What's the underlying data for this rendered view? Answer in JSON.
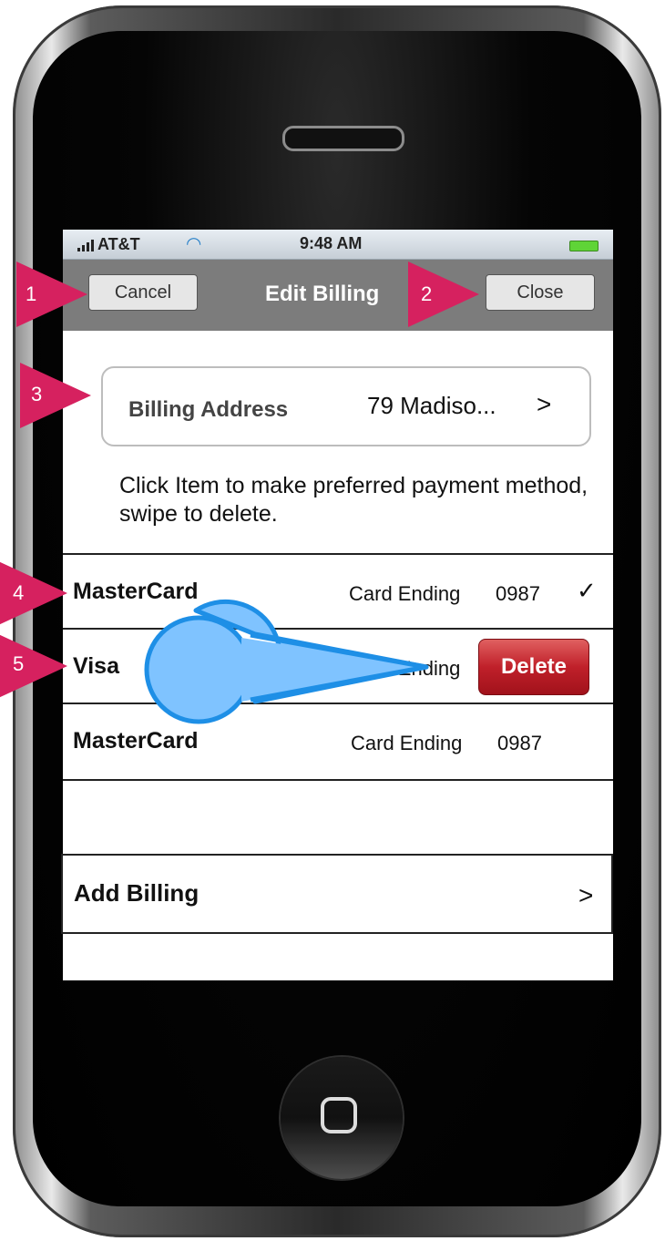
{
  "status_bar": {
    "carrier": "AT&T",
    "time": "9:48 AM"
  },
  "nav": {
    "title": "Edit Billing",
    "cancel_label": "Cancel",
    "close_label": "Close"
  },
  "billing_address": {
    "label": "Billing Address",
    "value": "79 Madiso...",
    "chevron": ">"
  },
  "hint": "Click Item to make preferred payment method, swipe to delete.",
  "cards": [
    {
      "name": "MasterCard",
      "ending_label": "Card Ending",
      "ending_number": "0987",
      "check": "✓"
    },
    {
      "name": "Visa",
      "ending_label": "Card Ending",
      "delete_label": "Delete"
    },
    {
      "name": "MasterCard",
      "ending_label": "Card Ending",
      "ending_number": "0987"
    }
  ],
  "add_billing": {
    "label": "Add Billing",
    "chevron": ">"
  },
  "annotations": [
    "1",
    "2",
    "3",
    "4",
    "5"
  ],
  "colors": {
    "marker": "#d6215f",
    "nav_bar": "#7c7c7c",
    "delete": "#c0202a",
    "gesture": "#7fc3ff"
  }
}
